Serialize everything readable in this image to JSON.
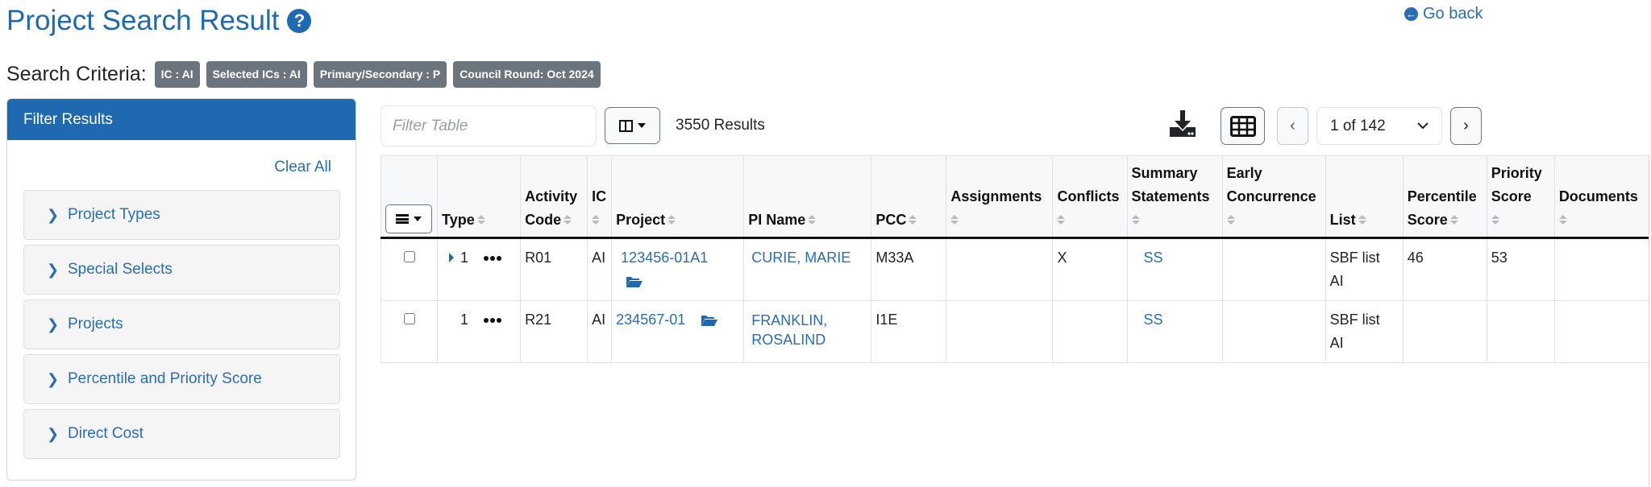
{
  "page": {
    "title": "Project Search Result",
    "go_back": "Go back"
  },
  "criteria": {
    "label": "Search Criteria:",
    "badges": [
      "IC : AI",
      "Selected ICs : AI",
      "Primary/Secondary : P",
      "Council Round: Oct 2024"
    ]
  },
  "sidebar": {
    "header": "Filter Results",
    "clear_all": "Clear All",
    "items": [
      {
        "label": "Project Types"
      },
      {
        "label": "Special Selects"
      },
      {
        "label": "Projects"
      },
      {
        "label": "Percentile and Priority Score"
      },
      {
        "label": "Direct Cost"
      }
    ]
  },
  "toolbar": {
    "filter_placeholder": "Filter Table",
    "filter_value": "",
    "results": "3550 Results",
    "page_select": "1 of 142",
    "prev": "‹",
    "next": "›"
  },
  "table": {
    "headers": [
      {
        "key": "select",
        "lines": []
      },
      {
        "key": "type",
        "lines": [
          "Type"
        ]
      },
      {
        "key": "activity_code",
        "lines": [
          "Activity",
          "Code"
        ]
      },
      {
        "key": "ic",
        "lines": [
          "IC"
        ]
      },
      {
        "key": "project",
        "lines": [
          "Project"
        ]
      },
      {
        "key": "pi_name",
        "lines": [
          "PI Name"
        ]
      },
      {
        "key": "pcc",
        "lines": [
          "PCC"
        ]
      },
      {
        "key": "assignments",
        "lines": [
          "Assignments"
        ]
      },
      {
        "key": "conflicts",
        "lines": [
          "Conflicts"
        ]
      },
      {
        "key": "summary_statements",
        "lines": [
          "Summary",
          "Statements"
        ]
      },
      {
        "key": "early_concurrence",
        "lines": [
          "Early",
          "Concurrence"
        ]
      },
      {
        "key": "list",
        "lines": [
          "List"
        ]
      },
      {
        "key": "percentile_score",
        "lines": [
          "Percentile",
          "Score"
        ]
      },
      {
        "key": "priority_score",
        "lines": [
          "Priority",
          "Score"
        ]
      },
      {
        "key": "documents",
        "lines": [
          "Documents"
        ]
      }
    ],
    "rows": [
      {
        "checked": false,
        "expandable": true,
        "type": "1",
        "activity_code": "R01",
        "ic": "AI",
        "project": "123456-01A1",
        "pi_name_1": "CURIE, MARIE",
        "pi_name_2": "",
        "pcc": "M33A",
        "assignments": "",
        "conflicts": "X",
        "summary_statements": "SS",
        "early_concurrence": "",
        "list_1": "SBF list",
        "list_2": "AI",
        "percentile_score": "46",
        "priority_score": "53",
        "documents": ""
      },
      {
        "checked": false,
        "expandable": false,
        "type": "1",
        "activity_code": "R21",
        "ic": "AI",
        "project": "234567-01",
        "pi_name_1": "FRANKLIN,",
        "pi_name_2": "ROSALIND",
        "pcc": "I1E",
        "assignments": "",
        "conflicts": "",
        "summary_statements": "SS",
        "early_concurrence": "",
        "list_1": "SBF list",
        "list_2": "AI",
        "percentile_score": "",
        "priority_score": "",
        "documents": ""
      }
    ]
  },
  "colors": {
    "brand_blue": "#1f69b0",
    "link_blue": "#2a6db5",
    "badge_gray": "#6c757d"
  }
}
